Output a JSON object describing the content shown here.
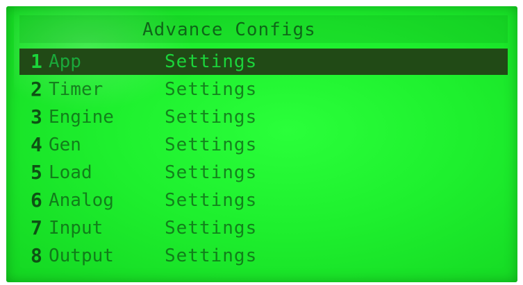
{
  "screen": {
    "title": "Advance Configs"
  },
  "menu": {
    "items": [
      {
        "num": "1",
        "name": "App",
        "value": "Settings",
        "selected": true
      },
      {
        "num": "2",
        "name": "Timer",
        "value": "Settings",
        "selected": false
      },
      {
        "num": "3",
        "name": "Engine",
        "value": "Settings",
        "selected": false
      },
      {
        "num": "4",
        "name": "Gen",
        "value": "Settings",
        "selected": false
      },
      {
        "num": "5",
        "name": "Load",
        "value": "Settings",
        "selected": false
      },
      {
        "num": "6",
        "name": "Analog",
        "value": "Settings",
        "selected": false
      },
      {
        "num": "7",
        "name": "Input",
        "value": "Settings",
        "selected": false
      },
      {
        "num": "8",
        "name": "Output",
        "value": "Settings",
        "selected": false
      }
    ]
  },
  "colors": {
    "background": "#1ef02e",
    "text": "#0e5214",
    "highlight": "#214a16"
  }
}
